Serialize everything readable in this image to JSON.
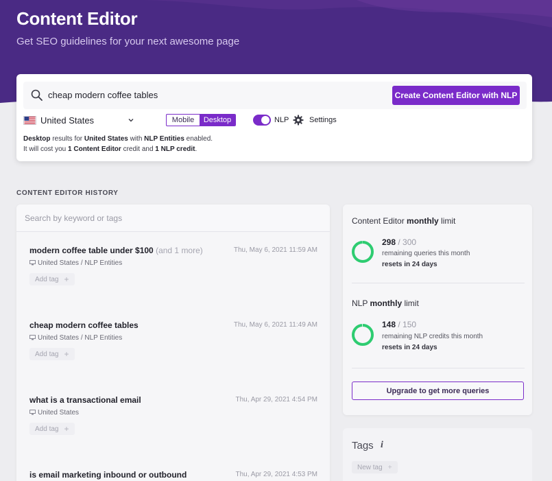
{
  "header": {
    "title": "Content Editor",
    "subtitle": "Get SEO guidelines for your next awesome page"
  },
  "search": {
    "query": "cheap modern coffee tables",
    "create_button": "Create Content Editor with NLP",
    "country": "United States",
    "device_mobile": "Mobile",
    "device_desktop": "Desktop",
    "device_selected": "Desktop",
    "nlp_label": "NLP",
    "nlp_enabled": true,
    "settings_label": "Settings",
    "info": {
      "l1_device": "Desktop",
      "l1_a": " results for ",
      "l1_country": "United States",
      "l1_b": " with ",
      "l1_nlp": "NLP Entities",
      "l1_c": " enabled.",
      "l2_a": "It will cost you ",
      "l2_credit1": "1 Content Editor",
      "l2_b": " credit and ",
      "l2_credit2": "1 NLP credit",
      "l2_c": "."
    }
  },
  "history": {
    "section_title": "CONTENT EDITOR HISTORY",
    "search_placeholder": "Search by keyword or tags",
    "add_tag_label": "Add tag",
    "items": [
      {
        "title": "modern coffee table under $100",
        "more": "(and 1 more)",
        "date": "Thu, May 6, 2021 11:59 AM",
        "meta": "United States / NLP Entities"
      },
      {
        "title": "cheap modern coffee tables",
        "more": "",
        "date": "Thu, May 6, 2021 11:49 AM",
        "meta": "United States / NLP Entities"
      },
      {
        "title": "what is a transactional email",
        "more": "",
        "date": "Thu, Apr 29, 2021 4:54 PM",
        "meta": "United States"
      },
      {
        "title": "is email marketing inbound or outbound",
        "more": "",
        "date": "Thu, Apr 29, 2021 4:53 PM",
        "meta": ""
      }
    ]
  },
  "limits": {
    "content_editor": {
      "heading_a": "Content Editor ",
      "heading_b": "monthly",
      "heading_c": " limit",
      "remaining": "298",
      "total": "/ 300",
      "remaining_value": 298,
      "total_value": 300,
      "desc": "remaining queries this month",
      "reset": "resets in 24 days"
    },
    "nlp": {
      "heading_a": "NLP ",
      "heading_b": "monthly",
      "heading_c": " limit",
      "remaining": "148",
      "total": "/ 150",
      "remaining_value": 148,
      "total_value": 150,
      "desc": "remaining NLP credits this month",
      "reset": "resets in 24 days"
    },
    "upgrade_button": "Upgrade to get more queries"
  },
  "tags": {
    "title": "Tags",
    "info_glyph": "i",
    "new_tag": "New tag"
  },
  "colors": {
    "brand_purple": "#7a2bc9",
    "hero_purple": "#4a2a84",
    "ring_green": "#2ecc71"
  },
  "icons": [
    "search-icon",
    "us-flag-icon",
    "chevron-down-icon",
    "gear-icon",
    "monitor-icon",
    "plus-icon",
    "info-icon"
  ]
}
